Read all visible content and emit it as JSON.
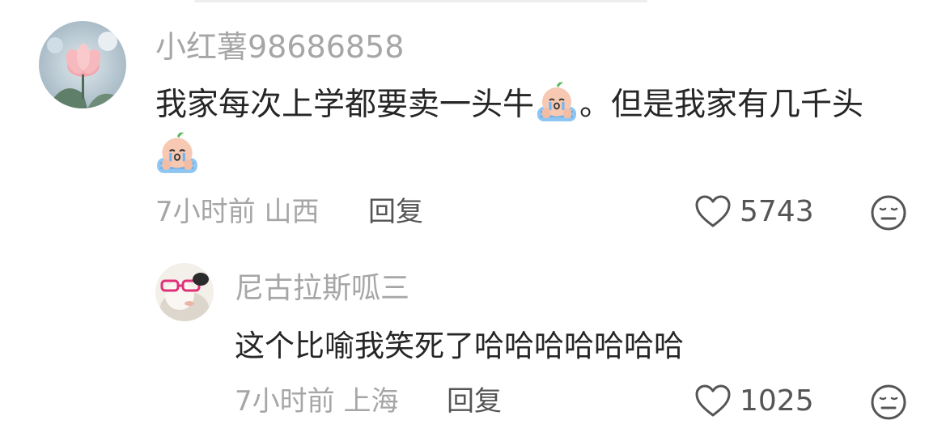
{
  "comments": [
    {
      "username": "小红薯98686858",
      "text_part1": "我家每次上学都要卖一头牛",
      "text_part2": "。但是我家有几千头",
      "time": "7小时前",
      "location": "山西",
      "reply_label": "回复",
      "likes": "5743",
      "emoji_icon": "crying-emoji"
    },
    {
      "username": "尼古拉斯呱三",
      "text": "这个比喻我笑死了哈哈哈哈哈哈哈",
      "time": "7小时前",
      "location": "上海",
      "reply_label": "回复",
      "likes": "1025"
    }
  ],
  "colors": {
    "username": "#a6a6a6",
    "text": "#262626",
    "meta": "#a6a6a6",
    "action": "#555555"
  }
}
